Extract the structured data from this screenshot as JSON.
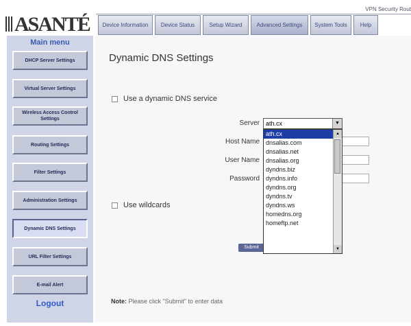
{
  "brand": {
    "logo_text": "ASANTÉ"
  },
  "window": {
    "title": "VPN Security Rout"
  },
  "tabs": [
    {
      "label": "Device Information"
    },
    {
      "label": "Device Status"
    },
    {
      "label": "Setup Wizard"
    },
    {
      "label": "Advanced Settings",
      "active": true
    },
    {
      "label": "System Tools"
    },
    {
      "label": "Help"
    }
  ],
  "sidebar": {
    "title": "Main menu",
    "items": [
      {
        "label": "DHCP Server Settings"
      },
      {
        "label": "Virtual Server Settings"
      },
      {
        "label": "Wireless Access Control Settings"
      },
      {
        "label": "Routing Settings"
      },
      {
        "label": "Filter Settings"
      },
      {
        "label": "Administration Settings"
      },
      {
        "label": "Dynamic DNS Settings",
        "active": true
      },
      {
        "label": "URL Filter Settings"
      },
      {
        "label": "E-mail Alert"
      }
    ],
    "logout": "Logout"
  },
  "main": {
    "title": "Dynamic DNS Settings",
    "use_ddns_label": "Use a dynamic DNS service",
    "use_wildcards_label": "Use wildcards",
    "server_label": "Server",
    "host_name_label": "Host Name",
    "user_name_label": "User Name",
    "password_label": "Password",
    "server_selected": "ath.cx",
    "server_options": [
      "ath.cx",
      "dnsalias.com",
      "dnsalias.net",
      "dnsalias.org",
      "dyndns.biz",
      "dyndns.info",
      "dyndns.org",
      "dyndns.tv",
      "dyndns.ws",
      "homedns.org",
      "homeftp.net"
    ],
    "submit_label": "Submit",
    "note_label": "Note:",
    "note_text": "Please click \"Submit\" to enter data"
  },
  "colors": {
    "sidebar_bg": "#cfd5e6",
    "tab_text": "#3a4a7a",
    "link": "#2d5bc8",
    "selected_option": "#1f3da6"
  }
}
